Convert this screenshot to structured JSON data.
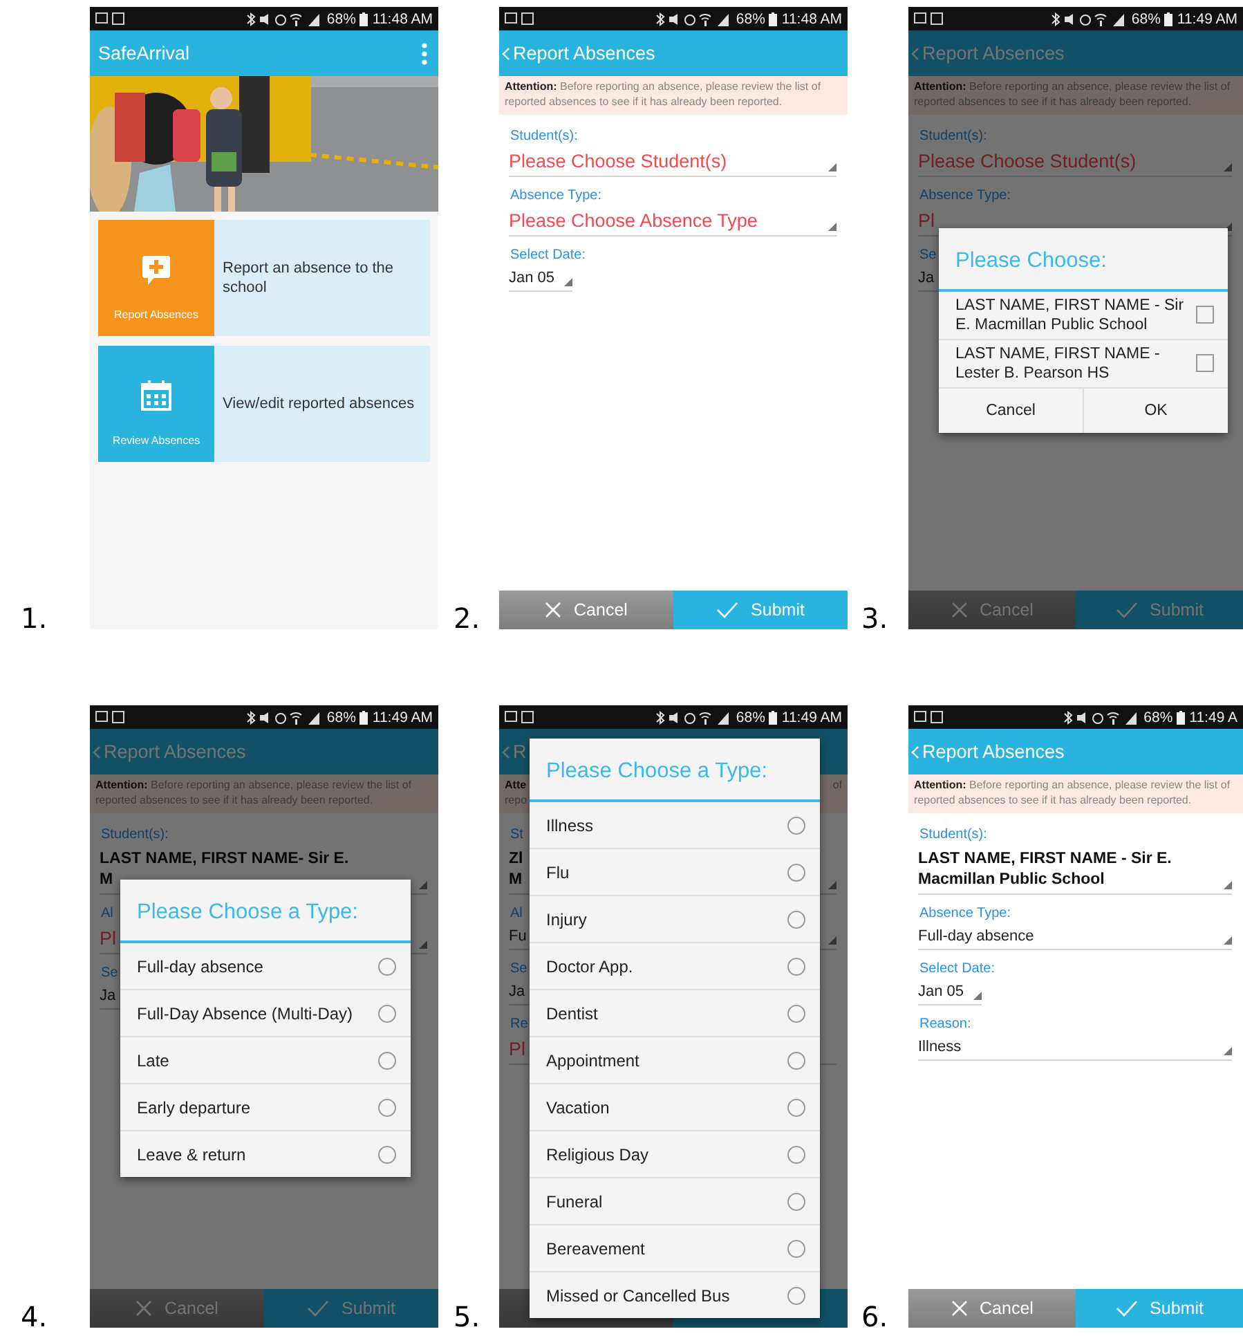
{
  "screens": [
    {
      "number": "1.",
      "kind": "home",
      "status": {
        "time": "11:48 AM",
        "battery": "68%"
      },
      "appbar": {
        "title": "SafeArrival"
      },
      "tiles": [
        {
          "label": "Report Absences",
          "description": "Report an absence to the school",
          "color": "#f7941d"
        },
        {
          "label": "Review Absences",
          "description": "View/edit reported absences",
          "color": "#29b3df"
        }
      ]
    },
    {
      "number": "2.",
      "kind": "form",
      "status": {
        "time": "11:48 AM",
        "battery": "68%"
      },
      "appbar": {
        "title": "Report Absences"
      },
      "notice": {
        "text": "**Attention:** Before reporting an absence, please review the list of reported absences to see if it has already been reported."
      },
      "fields": [
        {
          "label": "Student(s):",
          "value": "Please Choose Student(s)",
          "kind": "prompt",
          "arrow": true
        },
        {
          "label": "Absence Type:",
          "value": "Please Choose Absence Type",
          "kind": "prompt",
          "arrow": true
        },
        {
          "label": "Select Date:",
          "value": "Jan 05",
          "kind": "date",
          "arrow": true
        }
      ],
      "buttons": [
        {
          "label": "Cancel",
          "kind": "cancel"
        },
        {
          "label": "Submit",
          "kind": "submit"
        }
      ]
    },
    {
      "number": "3.",
      "kind": "form",
      "status": {
        "time": "11:49 AM",
        "battery": "68%"
      },
      "appbar": {
        "title": "Report Absences"
      },
      "notice": {
        "text": "**Attention:** Before reporting an absence, please review the list of reported absences to see if it has already been reported."
      },
      "fields": [
        {
          "label": "Student(s):",
          "value": "Please Choose Student(s)",
          "kind": "prompt",
          "arrow": true
        },
        {
          "label": "Absence Type:",
          "value": "Pl",
          "kind": "prompt",
          "arrow": true
        },
        {
          "label": "Se",
          "value": "Ja",
          "kind": "date",
          "arrow": false
        }
      ],
      "buttons": [
        {
          "label": "Cancel",
          "kind": "cancel"
        },
        {
          "label": "Submit",
          "kind": "submit"
        }
      ],
      "dialog": {
        "title": "Please Choose:",
        "kind": "check",
        "items": [
          {
            "label": "LAST NAME, FIRST NAME - Sir E. Macmillan Public School",
            "checked": false
          },
          {
            "label": "LAST NAME, FIRST NAME - Lester B. Pearson HS",
            "checked": false
          }
        ],
        "buttons": [
          "Cancel",
          "OK"
        ]
      }
    },
    {
      "number": "4.",
      "kind": "form",
      "status": {
        "time": "11:49 AM",
        "battery": "68%"
      },
      "appbar": {
        "title": "Report Absences"
      },
      "notice": {
        "text": "**Attention:** Before reporting an absence, please review the list of reported absences to see if it has already been reported."
      },
      "fields": [
        {
          "label": "Student(s):",
          "value": [
            "LAST NAME, FIRST NAME- Sir E.",
            "M"
          ],
          "kind": "bold",
          "arrow": true
        },
        {
          "label": "Al",
          "value": "Pl",
          "kind": "prompt",
          "arrow": true
        },
        {
          "label": "Se",
          "value": "Ja",
          "kind": "date",
          "arrow": false
        }
      ],
      "buttons": [
        {
          "label": "Cancel",
          "kind": "cancel"
        },
        {
          "label": "Submit",
          "kind": "submit"
        }
      ],
      "dialog": {
        "title": "Please Choose a Type:",
        "kind": "radio",
        "items": [
          {
            "label": "Full-day absence",
            "selected": false
          },
          {
            "label": "Full-Day Absence (Multi-Day)",
            "selected": false
          },
          {
            "label": "Late",
            "selected": false
          },
          {
            "label": "Early departure",
            "selected": false
          },
          {
            "label": "Leave & return",
            "selected": false
          }
        ]
      }
    },
    {
      "number": "5.",
      "kind": "form",
      "status": {
        "time": "11:49 AM",
        "battery": "68%"
      },
      "appbar": {
        "title": "R"
      },
      "notice": {
        "lines": [
          "**Atte**",
          "repo"
        ],
        "tail": "of"
      },
      "fields": [
        {
          "label": "St",
          "value": [
            "Zl",
            "M"
          ],
          "kind": "bold",
          "arrow": true
        },
        {
          "label": "Al",
          "value": "Fu",
          "kind": "plain",
          "arrow": true
        },
        {
          "label": "Se",
          "value": "Ja",
          "kind": "date",
          "arrow": false
        },
        {
          "label": "Re",
          "value": "Pl",
          "kind": "prompt",
          "arrow": false
        }
      ],
      "buttons": [
        {
          "kind": "cancel"
        },
        {
          "kind": "submit"
        }
      ],
      "dialog": {
        "title": "Please Choose a Type:",
        "kind": "radio",
        "items": [
          {
            "label": "Illness",
            "selected": false
          },
          {
            "label": "Flu",
            "selected": false
          },
          {
            "label": "Injury",
            "selected": false
          },
          {
            "label": "Doctor App.",
            "selected": false
          },
          {
            "label": "Dentist",
            "selected": false
          },
          {
            "label": "Appointment",
            "selected": false
          },
          {
            "label": "Vacation",
            "selected": false
          },
          {
            "label": "Religious Day",
            "selected": false
          },
          {
            "label": "Funeral",
            "selected": false
          },
          {
            "label": "Bereavement",
            "selected": false
          },
          {
            "label": "Missed or Cancelled Bus",
            "selected": false
          }
        ]
      }
    },
    {
      "number": "6.",
      "kind": "form",
      "status": {
        "time": "11:49 A",
        "battery": "68%"
      },
      "appbar": {
        "title": "Report Absences"
      },
      "notice": {
        "text": "**Attention:** Before reporting an absence, please review the list of reported absences to see if it has already been reported."
      },
      "fields": [
        {
          "label": "Student(s):",
          "value": "LAST NAME, FIRST NAME - Sir E. Macmillan Public School",
          "kind": "bold",
          "arrow": true
        },
        {
          "label": "Absence Type:",
          "value": "Full-day absence",
          "kind": "plain",
          "arrow": true
        },
        {
          "label": "Select Date:",
          "value": "Jan 05",
          "kind": "date",
          "arrow": true
        },
        {
          "label": "Reason:",
          "value": "Illness",
          "kind": "plain",
          "arrow": true
        }
      ],
      "buttons": [
        {
          "label": "Cancel",
          "kind": "cancel"
        },
        {
          "label": "Submit",
          "kind": "submit"
        }
      ]
    }
  ]
}
